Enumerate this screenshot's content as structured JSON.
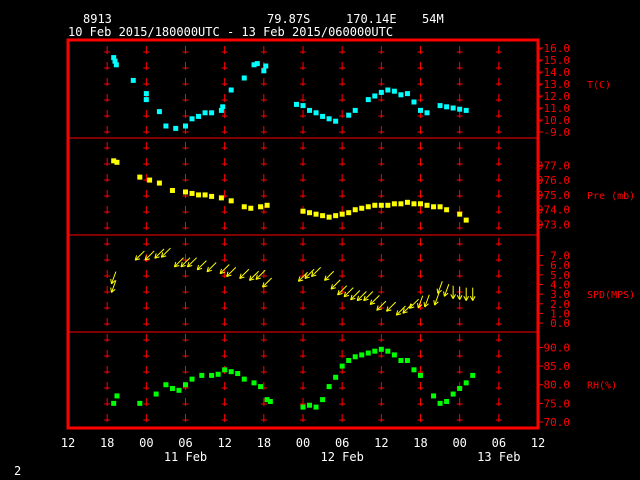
{
  "header": {
    "station": "8913",
    "lat": "79.87S",
    "lon": "170.14E",
    "elevation": "54M",
    "period": "10 Feb 2015/180000UTC - 13 Feb 2015/060000UTC"
  },
  "footer": {
    "page": "2"
  },
  "colors": {
    "frame": "#ff0000",
    "grid": "#ff0000",
    "labels": "#ff0000",
    "axis_text": "#ffffff",
    "temp": "#00ffff",
    "pres": "#ffff00",
    "wind": "#ffff00",
    "rh": "#00ff00"
  },
  "chart_data": {
    "type": "scatter",
    "x_unit": "hours since 10 Feb 2015 12:00 UTC",
    "xlim": [
      0,
      72
    ],
    "x_tick_labels": [
      "12",
      "18",
      "00",
      "06",
      "12",
      "18",
      "00",
      "06",
      "12",
      "18",
      "00",
      "06",
      "12"
    ],
    "day_labels": [
      {
        "x": 18,
        "label": "11 Feb"
      },
      {
        "x": 42,
        "label": "12 Feb"
      },
      {
        "x": 66,
        "label": "13 Feb"
      }
    ],
    "panels": [
      {
        "key": "temp",
        "label": "T(C)",
        "ylim": [
          -16,
          -9
        ],
        "inverted": true,
        "ticks": [
          "-9.0",
          "-10.0",
          "-11.0",
          "-12.0",
          "-13.0",
          "-14.0",
          "-15.0",
          "-16.0"
        ],
        "points": [
          [
            7,
            -15.2
          ],
          [
            7.2,
            -14.9
          ],
          [
            7.4,
            -14.6
          ],
          [
            10,
            -13.3
          ],
          [
            12,
            -12.2
          ],
          [
            12,
            -11.7
          ],
          [
            14,
            -10.7
          ],
          [
            15,
            -9.5
          ],
          [
            16.5,
            -9.3
          ],
          [
            18,
            -9.5
          ],
          [
            19,
            -10.1
          ],
          [
            20,
            -10.3
          ],
          [
            21,
            -10.6
          ],
          [
            22,
            -10.6
          ],
          [
            23.5,
            -10.8
          ],
          [
            23.7,
            -11.1
          ],
          [
            25,
            -12.5
          ],
          [
            27,
            -13.5
          ],
          [
            28.5,
            -14.6
          ],
          [
            29,
            -14.7
          ],
          [
            30,
            -14.1
          ],
          [
            30.3,
            -14.5
          ],
          [
            35,
            -11.3
          ],
          [
            36,
            -11.2
          ],
          [
            37,
            -10.8
          ],
          [
            38,
            -10.6
          ],
          [
            39,
            -10.3
          ],
          [
            40,
            -10.1
          ],
          [
            41,
            -9.9
          ],
          [
            43,
            -10.4
          ],
          [
            44,
            -10.8
          ],
          [
            46,
            -11.7
          ],
          [
            47,
            -12.0
          ],
          [
            48,
            -12.3
          ],
          [
            49,
            -12.5
          ],
          [
            50,
            -12.4
          ],
          [
            51,
            -12.1
          ],
          [
            52,
            -12.2
          ],
          [
            53,
            -11.5
          ],
          [
            54,
            -10.8
          ],
          [
            55,
            -10.6
          ],
          [
            57,
            -11.2
          ],
          [
            58,
            -11.1
          ],
          [
            59,
            -11.0
          ],
          [
            60,
            -10.9
          ],
          [
            61,
            -10.8
          ]
        ]
      },
      {
        "key": "pres",
        "label": "Pre (mb)",
        "ylim": [
          972.7,
          978.3
        ],
        "inverted": false,
        "ticks": [
          "977.0",
          "976.0",
          "975.0",
          "974.0",
          "973.0"
        ],
        "points": [
          [
            7,
            977.3
          ],
          [
            7.5,
            977.2
          ],
          [
            11,
            976.2
          ],
          [
            12.5,
            976.0
          ],
          [
            14,
            975.8
          ],
          [
            16,
            975.3
          ],
          [
            18,
            975.2
          ],
          [
            19,
            975.1
          ],
          [
            20,
            975.0
          ],
          [
            21,
            975.0
          ],
          [
            22,
            974.9
          ],
          [
            23.5,
            974.8
          ],
          [
            25,
            974.6
          ],
          [
            27,
            974.2
          ],
          [
            28,
            974.1
          ],
          [
            29.5,
            974.2
          ],
          [
            30.5,
            974.3
          ],
          [
            36,
            973.9
          ],
          [
            37,
            973.8
          ],
          [
            38,
            973.7
          ],
          [
            39,
            973.6
          ],
          [
            40,
            973.5
          ],
          [
            41,
            973.6
          ],
          [
            42,
            973.7
          ],
          [
            43,
            973.8
          ],
          [
            44,
            974.0
          ],
          [
            45,
            974.1
          ],
          [
            46,
            974.2
          ],
          [
            47,
            974.3
          ],
          [
            48,
            974.3
          ],
          [
            49,
            974.3
          ],
          [
            50,
            974.4
          ],
          [
            51,
            974.4
          ],
          [
            52,
            974.5
          ],
          [
            53,
            974.4
          ],
          [
            54,
            974.4
          ],
          [
            55,
            974.3
          ],
          [
            56,
            974.2
          ],
          [
            57,
            974.2
          ],
          [
            58,
            974.0
          ],
          [
            60,
            973.7
          ],
          [
            61,
            973.3
          ]
        ]
      },
      {
        "key": "wind",
        "label": "SPD(MPS)",
        "ylim": [
          -0.3,
          8.3
        ],
        "inverted": false,
        "ticks": [
          "7.0",
          "6.0",
          "5.0",
          "4.0",
          "3.0",
          "2.0",
          "1.0",
          "0.0"
        ],
        "points": [
          [
            7,
            4.7
          ],
          [
            7,
            3.8
          ],
          [
            11,
            7.0
          ],
          [
            12.5,
            7.0
          ],
          [
            14,
            7.2
          ],
          [
            15,
            7.3
          ],
          [
            17,
            6.3
          ],
          [
            18,
            6.3
          ],
          [
            19,
            6.3
          ],
          [
            20.5,
            6.0
          ],
          [
            22,
            5.8
          ],
          [
            24,
            5.6
          ],
          [
            25,
            5.3
          ],
          [
            27,
            5.1
          ],
          [
            28.5,
            4.9
          ],
          [
            29.5,
            5.0
          ],
          [
            30.5,
            4.2
          ],
          [
            36,
            4.8
          ],
          [
            37,
            5.1
          ],
          [
            38,
            5.3
          ],
          [
            40,
            4.9
          ],
          [
            41,
            4.0
          ],
          [
            42,
            3.4
          ],
          [
            43,
            3.2
          ],
          [
            44,
            2.9
          ],
          [
            45,
            2.8
          ],
          [
            46,
            2.8
          ],
          [
            47,
            2.4
          ],
          [
            48,
            1.8
          ],
          [
            49.5,
            1.7
          ],
          [
            51,
            1.3
          ],
          [
            52,
            1.5
          ],
          [
            53,
            2.0
          ],
          [
            54,
            2.2
          ],
          [
            55,
            2.3
          ],
          [
            56.5,
            2.5
          ],
          [
            57,
            3.7
          ],
          [
            58,
            3.4
          ],
          [
            59,
            3.2
          ],
          [
            60,
            3.1
          ],
          [
            61,
            3.0
          ],
          [
            62,
            3.0
          ]
        ],
        "directions_deg": [
          250,
          250,
          225,
          225,
          225,
          225,
          225,
          225,
          225,
          225,
          225,
          225,
          225,
          225,
          225,
          225,
          225,
          225,
          225,
          225,
          225,
          225,
          225,
          225,
          225,
          225,
          225,
          225,
          225,
          225,
          225,
          225,
          225,
          250,
          250,
          250,
          250,
          250,
          270,
          270,
          270,
          270
        ]
      },
      {
        "key": "rh",
        "label": "RH(%)",
        "ylim": [
          70,
          92
        ],
        "inverted": false,
        "ticks": [
          "90.0",
          "85.0",
          "80.0",
          "75.0",
          "70.0"
        ],
        "points": [
          [
            7,
            75.0
          ],
          [
            7.5,
            77.0
          ],
          [
            11,
            75.0
          ],
          [
            13.5,
            77.5
          ],
          [
            15,
            80.0
          ],
          [
            16,
            79.0
          ],
          [
            17,
            78.5
          ],
          [
            18,
            80.0
          ],
          [
            19,
            81.5
          ],
          [
            20.5,
            82.5
          ],
          [
            22,
            82.5
          ],
          [
            23,
            82.8
          ],
          [
            24,
            84.0
          ],
          [
            25,
            83.5
          ],
          [
            26,
            83.0
          ],
          [
            27,
            81.5
          ],
          [
            28.5,
            80.5
          ],
          [
            29.5,
            79.5
          ],
          [
            30.5,
            76.0
          ],
          [
            31,
            75.5
          ],
          [
            36,
            74.0
          ],
          [
            37,
            74.5
          ],
          [
            38,
            74.0
          ],
          [
            39,
            76.0
          ],
          [
            40,
            79.5
          ],
          [
            41,
            82.0
          ],
          [
            42,
            85.0
          ],
          [
            43,
            86.5
          ],
          [
            44,
            87.5
          ],
          [
            45,
            88.0
          ],
          [
            46,
            88.5
          ],
          [
            47,
            89.0
          ],
          [
            48,
            89.5
          ],
          [
            49,
            89.0
          ],
          [
            50,
            88.0
          ],
          [
            51,
            86.5
          ],
          [
            52,
            86.5
          ],
          [
            53,
            84.0
          ],
          [
            54,
            82.5
          ],
          [
            56,
            77.0
          ],
          [
            57,
            75.0
          ],
          [
            58,
            75.5
          ],
          [
            59,
            77.5
          ],
          [
            60,
            79.0
          ],
          [
            61,
            80.5
          ],
          [
            62,
            82.5
          ]
        ]
      }
    ]
  }
}
